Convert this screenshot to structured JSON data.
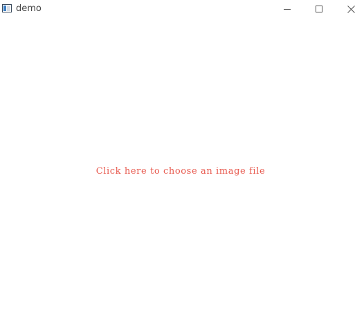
{
  "window": {
    "title": "demo",
    "app_icon": "window-app-icon",
    "controls": {
      "minimize_icon": "minimize-icon",
      "maximize_icon": "maximize-icon",
      "close_icon": "close-icon"
    }
  },
  "main": {
    "prompt_text": "Click here to choose an image file",
    "prompt_color": "#e85a4f"
  }
}
